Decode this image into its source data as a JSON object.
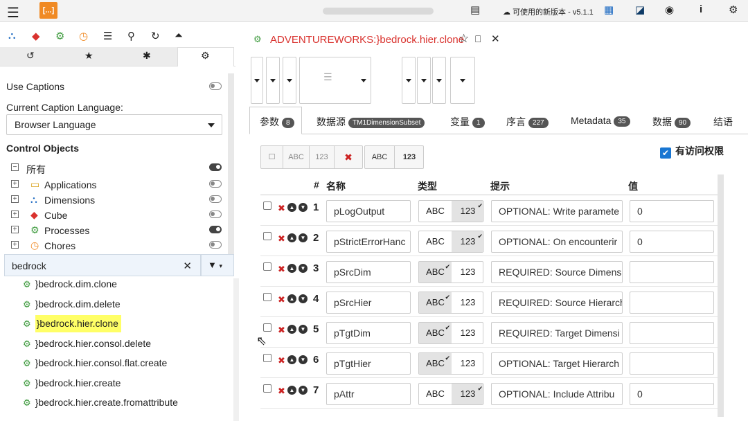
{
  "topbar": {
    "update_notice": "可使用的新版本 - v5.1.1"
  },
  "left": {
    "use_captions": "Use Captions",
    "caption_language_label": "Current Caption Language:",
    "caption_language": "Browser Language",
    "control_objects": "Control Objects",
    "tree": [
      {
        "label": "所有",
        "toggle": "on"
      },
      {
        "label": "Applications",
        "toggle": "off"
      },
      {
        "label": "Dimensions",
        "toggle": "off"
      },
      {
        "label": "Cube",
        "toggle": "off"
      },
      {
        "label": "Processes",
        "toggle": "on"
      },
      {
        "label": "Chores",
        "toggle": "off"
      }
    ],
    "search_value": "bedrock",
    "processes": [
      "}bedrock.dim.clone",
      "}bedrock.dim.delete",
      "}bedrock.hier.clone",
      "}bedrock.hier.consol.delete",
      "}bedrock.hier.consol.flat.create",
      "}bedrock.hier.create",
      "}bedrock.hier.create.fromattribute"
    ],
    "selected_process": "}bedrock.hier.clone"
  },
  "doc": {
    "title": "ADVENTUREWORKS:}bedrock.hier.clone",
    "tabs": [
      {
        "label": "参数",
        "count": "8"
      },
      {
        "label": "数据源",
        "count": "TM1DimensionSubset"
      },
      {
        "label": "变量",
        "count": "1"
      },
      {
        "label": "序言",
        "count": "227"
      },
      {
        "label": "Metadata",
        "count": "35"
      },
      {
        "label": "数据",
        "count": "90"
      },
      {
        "label": "结语",
        "count": ""
      }
    ],
    "buttons": {
      "abc": "ABC",
      "n123": "123",
      "add_abc": "ABC",
      "add_123": "123"
    },
    "access_label": "有访问权限",
    "headers": {
      "num": "#",
      "name": "名称",
      "type": "类型",
      "hint": "提示",
      "value": "值"
    },
    "type_labels": {
      "abc": "ABC",
      "n123": "123"
    },
    "params": [
      {
        "n": "1",
        "name": "pLogOutput",
        "type": "123",
        "hint": "OPTIONAL: Write paramete",
        "value": "0"
      },
      {
        "n": "2",
        "name": "pStrictErrorHanc",
        "type": "123",
        "hint": "OPTIONAL: On encounterir",
        "value": "0"
      },
      {
        "n": "3",
        "name": "pSrcDim",
        "type": "ABC",
        "hint": "REQUIRED: Source Dimens",
        "value": ""
      },
      {
        "n": "4",
        "name": "pSrcHier",
        "type": "ABC",
        "hint": "REQUIRED: Source Hierarch",
        "value": ""
      },
      {
        "n": "5",
        "name": "pTgtDim",
        "type": "ABC",
        "hint": "REQUIRED: Target Dimensi",
        "value": ""
      },
      {
        "n": "6",
        "name": "pTgtHier",
        "type": "ABC",
        "hint": "OPTIONAL: Target Hierarch",
        "value": ""
      },
      {
        "n": "7",
        "name": "pAttr",
        "type": "123",
        "hint": "OPTIONAL: Include Attribu",
        "value": "0"
      }
    ]
  }
}
